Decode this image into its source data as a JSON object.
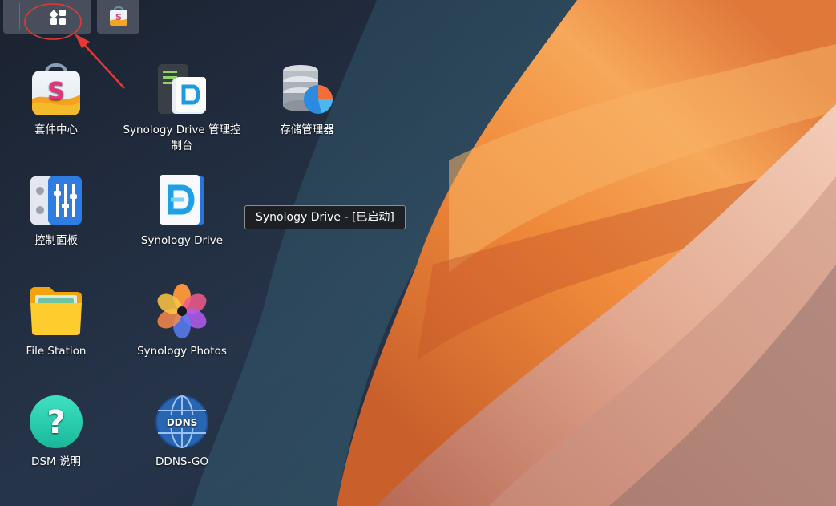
{
  "taskbar": {
    "main_menu": {
      "icon": "grid-icon"
    },
    "open_app": {
      "icon": "package-center-icon"
    }
  },
  "desktop": {
    "icons": [
      {
        "label": "套件中心",
        "icon": "package-center-icon"
      },
      {
        "label": "Synology Drive 管理控制台",
        "icon": "drive-admin-console-icon"
      },
      {
        "label": "存储管理器",
        "icon": "storage-manager-icon"
      },
      {
        "label": "控制面板",
        "icon": "control-panel-icon"
      },
      {
        "label": "Synology Drive",
        "icon": "synology-drive-icon"
      },
      {
        "label": "File Station",
        "icon": "folder-icon"
      },
      {
        "label": "Synology Photos",
        "icon": "photos-flower-icon"
      },
      {
        "label": "DSM 说明",
        "icon": "help-icon"
      },
      {
        "label": "DDNS-GO",
        "icon": "ddns-globe-icon"
      }
    ]
  },
  "tooltip": {
    "text": "Synology Drive - [已启动]"
  },
  "annotation": {
    "color": "#e53935"
  }
}
